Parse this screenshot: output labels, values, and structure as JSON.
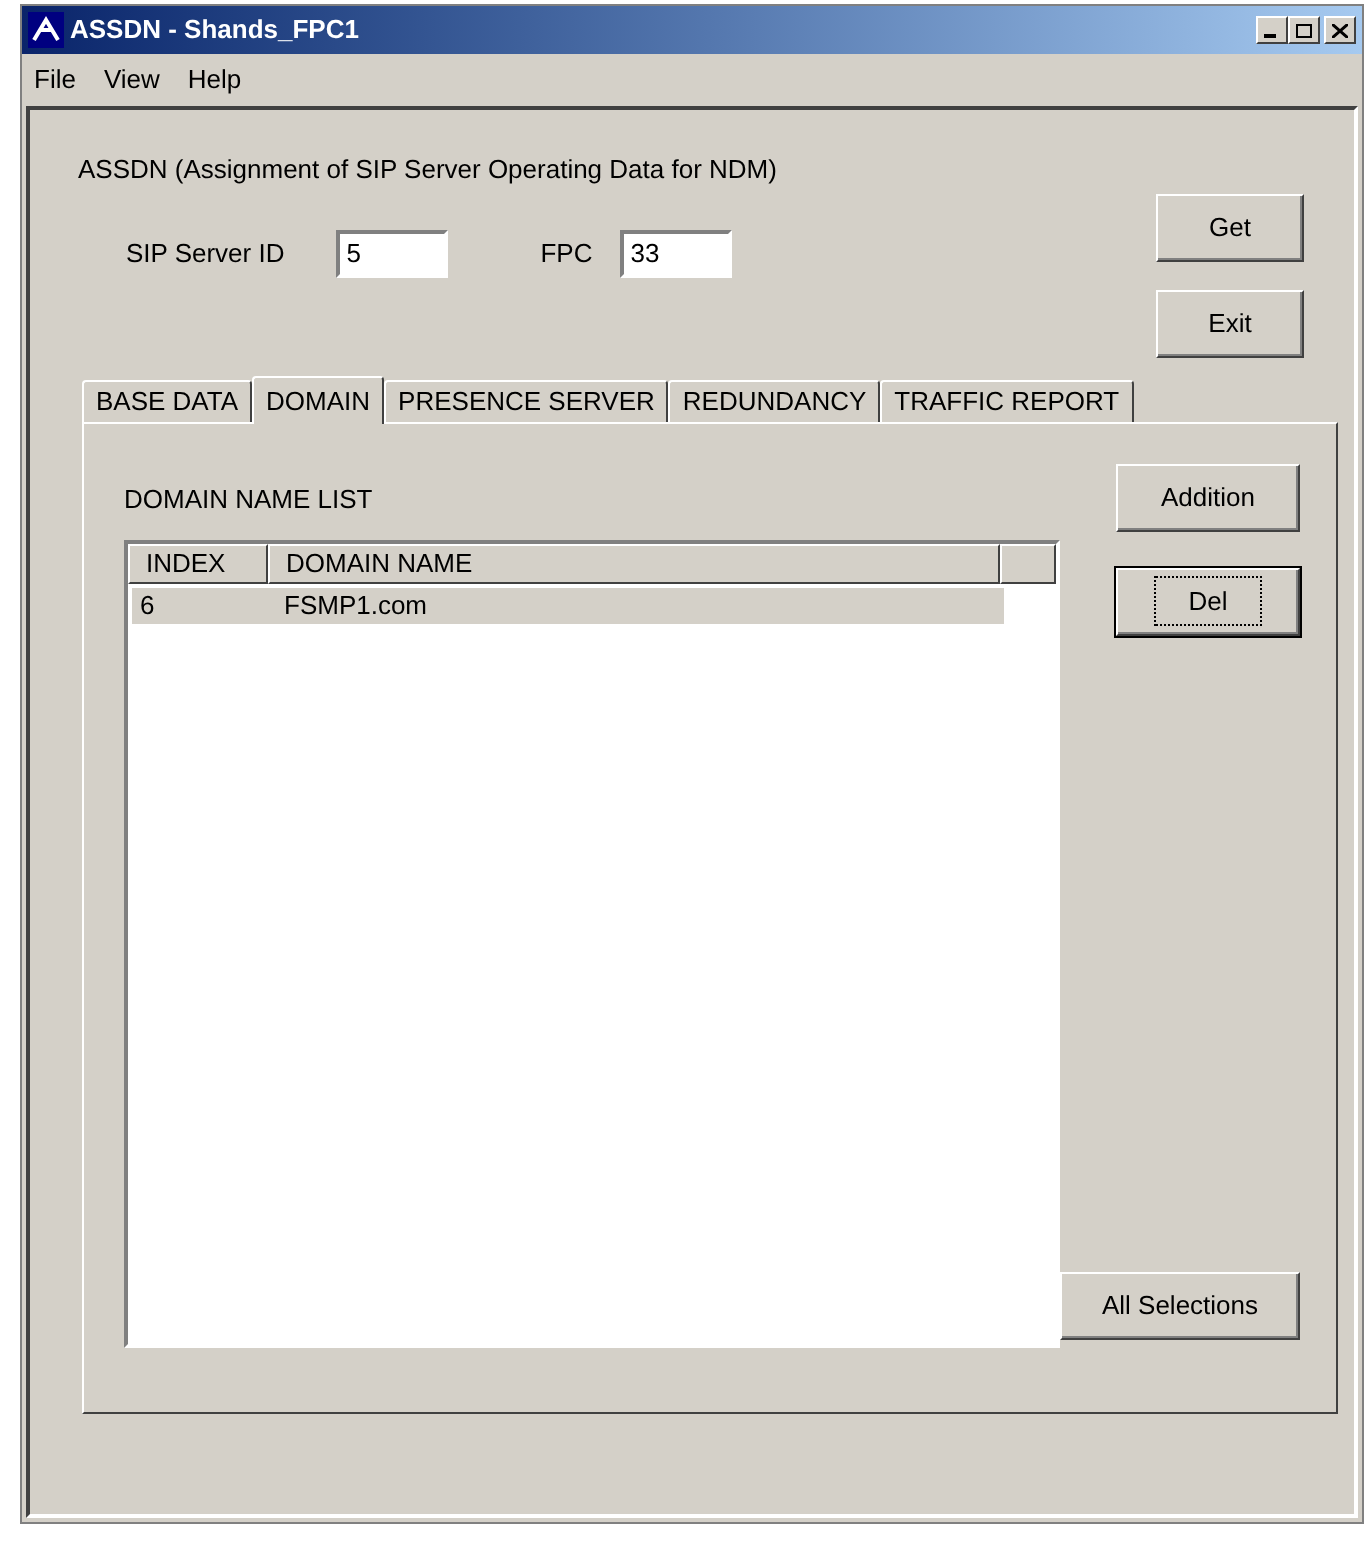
{
  "window": {
    "title": "ASSDN - Shands_FPC1"
  },
  "menu": [
    "File",
    "View",
    "Help"
  ],
  "heading": "ASSDN (Assignment of SIP Server Operating Data for NDM)",
  "fields": [
    {
      "label": "SIP Server ID",
      "value": "5"
    },
    {
      "label": "FPC",
      "value": "33"
    }
  ],
  "top_buttons": [
    {
      "label": "Get",
      "default": false
    },
    {
      "label": "Exit",
      "default": false
    }
  ],
  "tabs": [
    {
      "label": "BASE DATA",
      "selected": false
    },
    {
      "label": "DOMAIN",
      "selected": true
    },
    {
      "label": "PRESENCE SERVER",
      "selected": false
    },
    {
      "label": "REDUNDANCY",
      "selected": false
    },
    {
      "label": "TRAFFIC REPORT",
      "selected": false
    }
  ],
  "list_title": "DOMAIN NAME LIST",
  "table": {
    "columns": [
      "INDEX",
      "DOMAIN NAME"
    ],
    "rows": [
      {
        "cells": [
          "6",
          "FSMP1.com"
        ],
        "selected": true
      }
    ]
  },
  "side_buttons": [
    {
      "label": "Addition",
      "default": false
    },
    {
      "label": "Del",
      "default": true
    }
  ],
  "bottom_button": {
    "label": "All Selections",
    "default": false
  }
}
